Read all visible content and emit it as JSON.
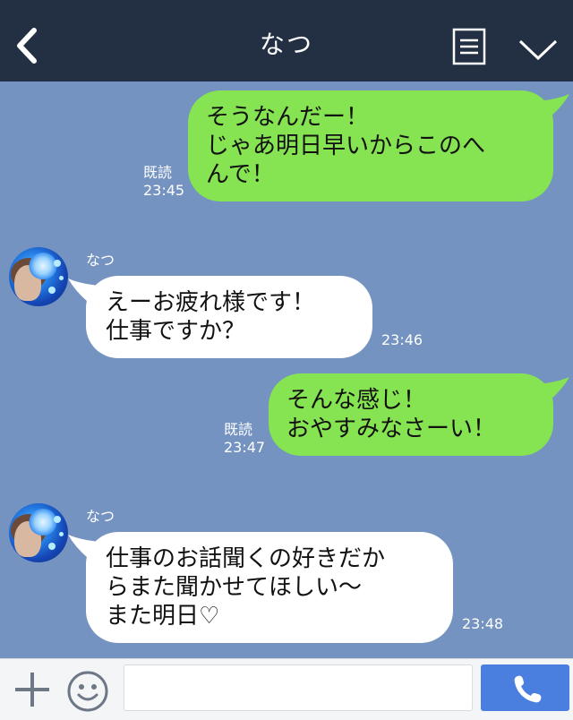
{
  "header": {
    "title": "なつ",
    "icons": [
      "chevron-left-icon",
      "note-icon",
      "chevron-down-icon"
    ]
  },
  "messages": [
    {
      "direction": "out",
      "text": "そうなんだー！\nじゃあ明日早いからこのへ\nんで！",
      "read": "既読",
      "time": "23:45"
    },
    {
      "direction": "in",
      "sender": "なつ",
      "text": "えーお疲れ様です！\n仕事ですか？",
      "time": "23:46"
    },
    {
      "direction": "out",
      "text": "そんな感じ！\nおやすみなさーい！",
      "read": "既読",
      "time": "23:47"
    },
    {
      "direction": "in",
      "sender": "なつ",
      "text": "仕事のお話聞くの好きだか\nらまた聞かせてほしい〜\nまた明日♡",
      "time": "23:48"
    }
  ],
  "footer": {
    "input_value": "",
    "icons": [
      "plus-icon",
      "smiley-icon",
      "phone-icon"
    ]
  },
  "colors": {
    "header_bg": "#233044",
    "chat_bg": "#7493c0",
    "out_bubble": "#86e351",
    "in_bubble": "#ffffff",
    "call_button": "#4a7fe0"
  }
}
